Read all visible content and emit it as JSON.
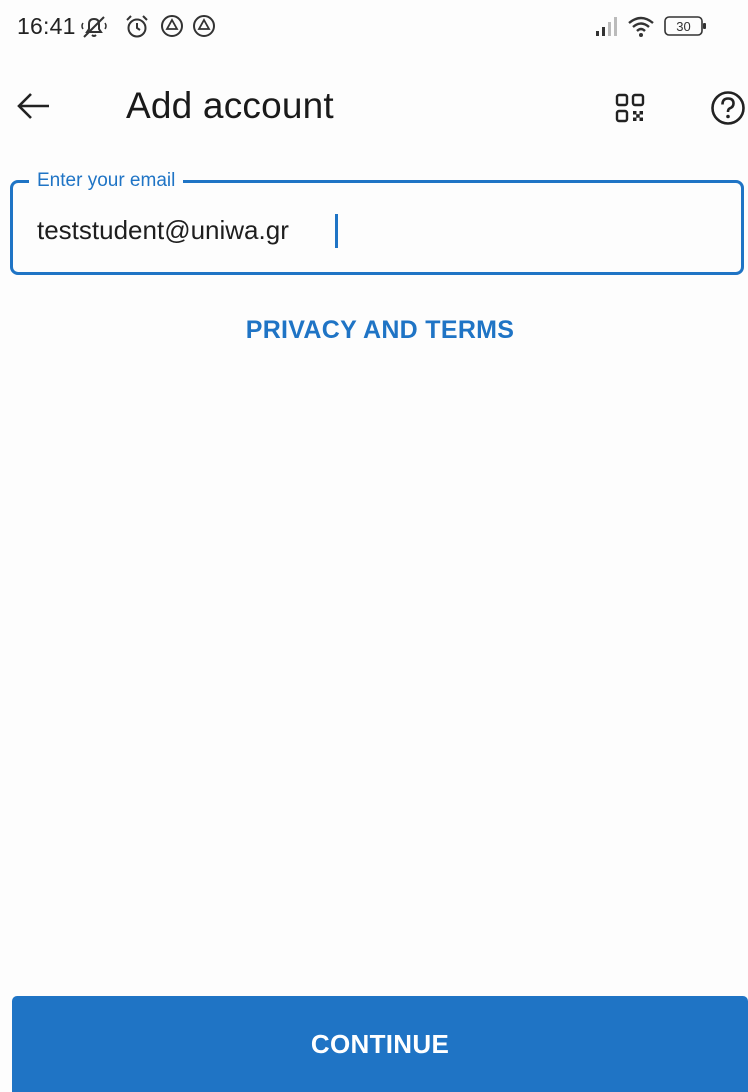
{
  "status_bar": {
    "time": "16:41",
    "battery_level": "30",
    "icons": [
      "notifications-muted-icon",
      "alarm-icon",
      "drive-icon",
      "drive-icon",
      "signal-icon",
      "wifi-icon",
      "battery-icon"
    ]
  },
  "toolbar": {
    "title": "Add account",
    "back_icon": "arrow-left-icon",
    "qr_icon": "qr-code-icon",
    "help_icon": "help-circle-icon"
  },
  "email_field": {
    "label": "Enter your email",
    "value": "teststudent@uniwa.gr"
  },
  "privacy_link": "PRIVACY AND TERMS",
  "continue_button": "CONTINUE",
  "colors": {
    "accent": "#1f74c5",
    "background": "#fdfdfd",
    "text": "#1e1e1e"
  }
}
